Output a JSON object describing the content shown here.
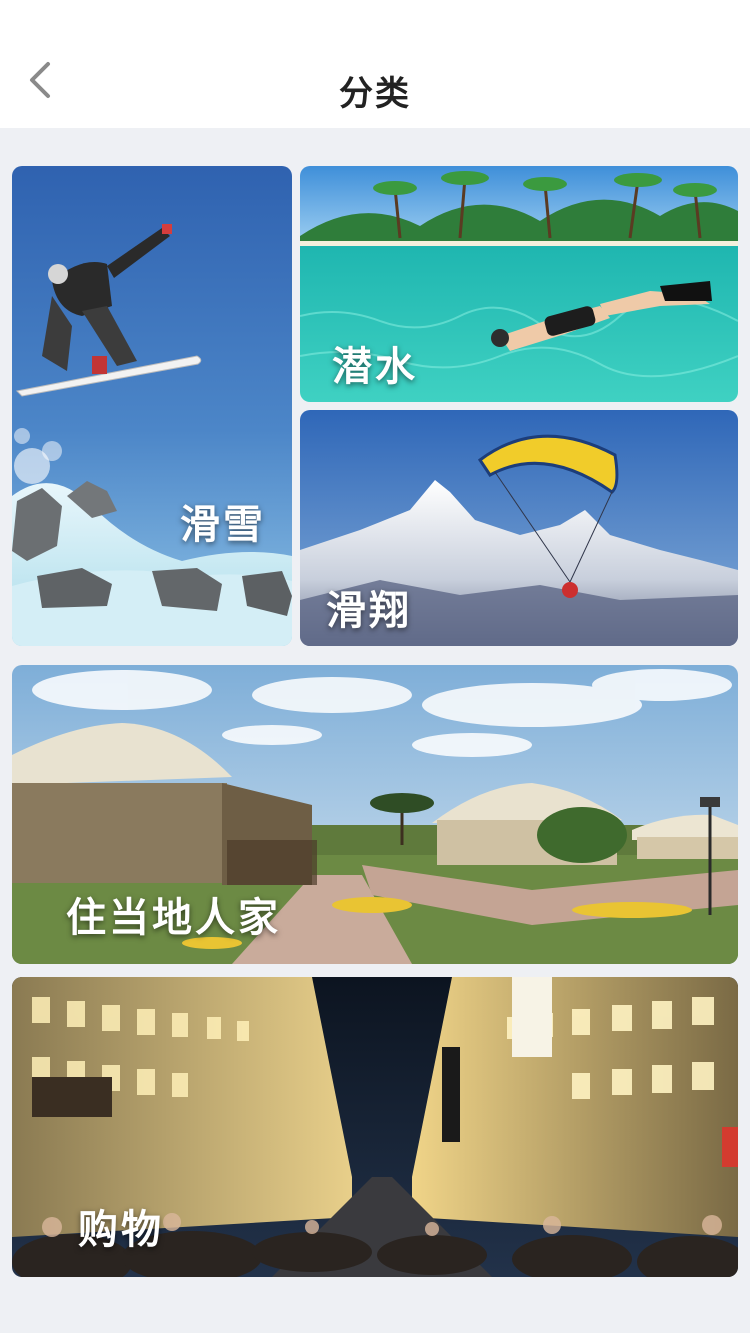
{
  "header": {
    "title": "分类",
    "back_icon": "chevron-left-icon"
  },
  "categories": [
    {
      "label": "滑雪"
    },
    {
      "label": "潜水"
    },
    {
      "label": "滑翔"
    },
    {
      "label": "住当地人家"
    },
    {
      "label": "购物"
    }
  ],
  "colors": {
    "page_background": "#eef0f4",
    "header_background": "#ffffff",
    "title_text": "#222222",
    "label_text": "#ffffff"
  }
}
